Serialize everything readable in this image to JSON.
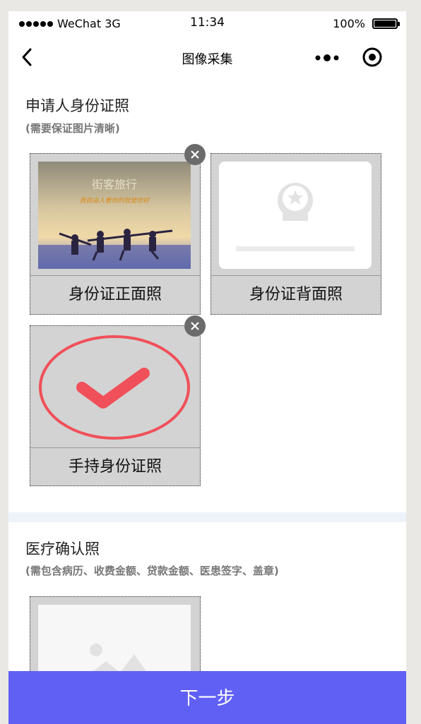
{
  "status_bar": {
    "carrier": "WeChat 3G",
    "time": "11:34",
    "battery": "100%"
  },
  "nav": {
    "title": "图像采集"
  },
  "id_section": {
    "title": "申请人身份证照",
    "subtitle": "(需要保证图片清晰)",
    "cards": [
      {
        "label": "身份证正面照",
        "photo_text_1": "街客旅行",
        "photo_text_2": "我自由人看你的就是你好"
      },
      {
        "label": "身份证背面照"
      },
      {
        "label": "手持身份证照"
      }
    ]
  },
  "medical_section": {
    "title": "医疗确认照",
    "subtitle": "(需包含病历、收费金额、贷款金额、医患签字、盖章)"
  },
  "footer": {
    "next_label": "下一步"
  },
  "colors": {
    "primary": "#6060f5",
    "check_red": "#f0505a",
    "card_bg": "#d3d3d3"
  }
}
